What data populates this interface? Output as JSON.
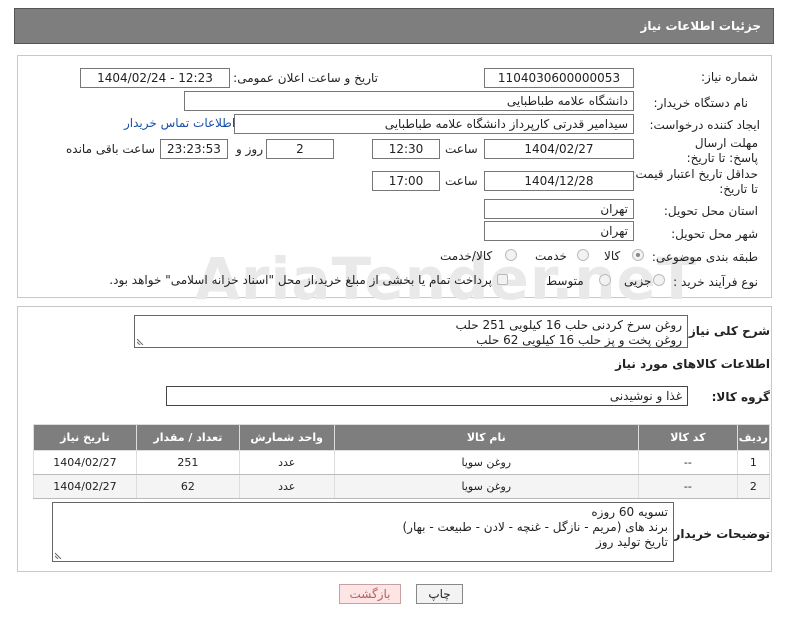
{
  "header": {
    "title": "جزئیات اطلاعات نیاز"
  },
  "form": {
    "need_number_label": "شماره نیاز:",
    "need_number": "1104030600000053",
    "announce_label": "تاریخ و ساعت اعلان عمومی:",
    "announce_value": "1404/02/24 - 12:23",
    "buyer_label": "نام دستگاه خریدار:",
    "buyer_value": "دانشگاه علامه طباطبایی",
    "creator_label": "ایجاد کننده درخواست:",
    "creator_value": "سیدامیر قدرتی کارپرداز دانشگاه علامه طباطبایی",
    "contact_link": "اطلاعات تماس خریدار",
    "deadline_label": "مهلت ارسال پاسخ: تا تاریخ:",
    "deadline_date": "1404/02/27",
    "deadline_time_label": "ساعت",
    "deadline_time": "12:30",
    "days_value": "2",
    "days_label": "روز و",
    "remaining_time": "23:23:53",
    "remaining_label": "ساعت باقی مانده",
    "validity_label": "حداقل تاریخ اعتبار قیمت: تا تاریخ:",
    "validity_date": "1404/12/28",
    "validity_time_label": "ساعت",
    "validity_time": "17:00",
    "province_label": "استان محل تحویل:",
    "province_value": "تهران",
    "city_label": "شهر محل تحویل:",
    "city_value": "تهران",
    "category_label": "طبقه بندی موضوعی:",
    "category_options": [
      "کالا",
      "خدمت",
      "کالا/خدمت"
    ],
    "process_label": "نوع فرآیند خرید :",
    "process_options": [
      "جزیی",
      "متوسط"
    ],
    "payment_note": "پرداخت تمام یا بخشی از مبلغ خرید،از محل \"اسناد خزانه اسلامی\" خواهد بود."
  },
  "watermark": "AriaTender.neT",
  "description": {
    "label": "شرح کلی نیاز:",
    "lines": [
      "روغن سرخ کردنی حلب 16 کیلویی 251 حلب",
      "روغن پخت و پز حلب 16 کیلویی 62 حلب"
    ]
  },
  "goods": {
    "section_title": "اطلاعات کالاهای مورد نیاز",
    "group_label": "گروه کالا:",
    "group_value": "غذا و نوشیدنی",
    "columns": [
      "ردیف",
      "کد کالا",
      "نام کالا",
      "واحد شمارش",
      "تعداد / مقدار",
      "تاریخ نیاز"
    ],
    "rows": [
      [
        "1",
        "--",
        "روغن سویا",
        "عدد",
        "251",
        "1404/02/27"
      ],
      [
        "2",
        "--",
        "روغن سویا",
        "عدد",
        "62",
        "1404/02/27"
      ]
    ]
  },
  "buyer_notes": {
    "label": "توضیحات خریدار:",
    "lines": [
      "تسویه 60 روزه",
      "برند های (مریم - نازگل - غنچه - لادن - طبیعت - بهار)",
      "تاریخ تولید روز"
    ]
  },
  "buttons": {
    "print": "چاپ",
    "back": "بازگشت"
  },
  "colors": {
    "header_bg": "#7e7e7e",
    "link": "#1a4fa8",
    "back_button_bg": "#fde5e5"
  }
}
